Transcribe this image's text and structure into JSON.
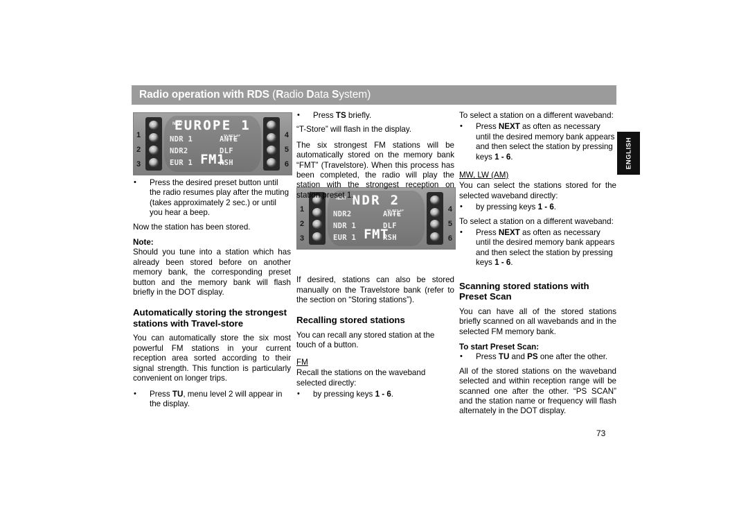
{
  "header": {
    "title_plain_1": "Radio operation with RDS ",
    "title_paren_open": "(",
    "title_r": "R",
    "title_adio": "adio ",
    "title_d": "D",
    "title_ata": "ata ",
    "title_s": "S",
    "title_ystem": "ystem",
    "title_paren_close": ")",
    "full_title": "Radio operation with RDS (Radio Data System)"
  },
  "side_tab": {
    "label": "ENGLISH"
  },
  "page_number": "73",
  "displays": [
    {
      "name": "europe-1-display",
      "next_label": "NEXT",
      "station": "EUROPE  1",
      "band": "FM1",
      "mini_flags_line1": "TA PTY AF",
      "mini_flags_line2": "CD IN",
      "left_numbers": [
        "1",
        "2",
        "3"
      ],
      "right_numbers": [
        "4",
        "5",
        "6"
      ],
      "rows": [
        {
          "bank": "NDR 1",
          "marker": "▸",
          "func": "ANTE"
        },
        {
          "bank": "NDR2",
          "marker": "",
          "func": "DLF"
        },
        {
          "bank": "EUR 1",
          "marker": "◂",
          "func": "RSH"
        }
      ]
    },
    {
      "name": "ndr-2-display",
      "next_label": "NEXT",
      "station": "NDR  2",
      "band": "FMT",
      "mini_flags_line1": "TA PTY AF",
      "mini_flags_line2": "CD IN",
      "left_numbers": [
        "1",
        "2",
        "3"
      ],
      "right_numbers": [
        "4",
        "5",
        "6"
      ],
      "rows": [
        {
          "bank": "NDR2",
          "marker": "◂",
          "func": "ANTE"
        },
        {
          "bank": "NDR 1",
          "marker": "",
          "func": "DLF"
        },
        {
          "bank": "EUR 1",
          "marker": "",
          "func": "RSH"
        }
      ]
    }
  ],
  "column1": {
    "bullet1": {
      "pre": "Press the desired preset button until the radio resumes play after the muting (takes approximately 2 sec.) or until you hear a beep."
    },
    "para_stored": "Now the station has been stored.",
    "note_head": "Note:",
    "note_body": "Should you tune into a station which has already been stored before on another memory bank, the corresponding preset button and the memory bank will flash briefly in the DOT display.",
    "heading_travelstore": "Automatically storing the strongest stations with Travel-store",
    "para_travelstore": "You can automatically store the six most powerful FM stations in your current reception area sorted according to their signal strength. This function is particularly convenient on longer trips.",
    "bullet_tu_pre": "Press ",
    "bullet_tu_bold": "TU",
    "bullet_tu_post": ", menu level 2 will appear in the display."
  },
  "column2": {
    "bullet_ts_pre": "Press ",
    "bullet_ts_bold": "TS",
    "bullet_ts_post": " briefly.",
    "para_tstore": "“T-Store” will flash in the display.",
    "para_six_strongest": "The six strongest FM stations will be automatically stored on the memory bank “FMT” (Travelstore). When this process has been completed, the radio will play the station with the strongest reception on station preset 1.",
    "para_if_desired": "If desired, stations can also be stored manually on the Travelstore bank (refer to the section on “Storing stations”).",
    "heading_recalling": "Recalling stored stations",
    "para_recall": "You can recall any stored station at the touch of a button.",
    "sub_fm": "FM",
    "para_recall_direct": "Recall the stations on the waveband selected directly:",
    "bullet_keys_pre": "by pressing keys ",
    "bullet_keys_bold": "1 - 6",
    "bullet_keys_post": "."
  },
  "column3": {
    "para_select_other_1": "To select a station on a different waveband:",
    "bullet_next_1_pre": "Press ",
    "bullet_next_1_bold": "NEXT",
    "bullet_next_1_mid": " as often as necessary until the desired memory bank appears and then select the station by pressing keys ",
    "bullet_next_1_bold2": "1 - 6",
    "bullet_next_1_post": ".",
    "sub_mwlw": "MW, LW (AM)",
    "para_select_stored": "You can select the stations stored for the selected waveband directly:",
    "bullet_keys_pre": "by pressing keys ",
    "bullet_keys_bold": "1 - 6",
    "bullet_keys_post": ".",
    "para_select_other_2": "To select a station on a different waveband:",
    "bullet_next_2_pre": "Press ",
    "bullet_next_2_bold": "NEXT",
    "bullet_next_2_mid": " as often as necessary until the desired memory bank appears and then select the station by pressing keys ",
    "bullet_next_2_bold2": "1 - 6",
    "bullet_next_2_post": ".",
    "heading_preset_scan": "Scanning stored stations with Preset Scan",
    "para_scan": "You can have all of the stored stations briefly scanned on all wavebands and in the selected FM memory bank.",
    "sub_start": "To start Preset Scan:",
    "bullet_start_pre": "Press ",
    "bullet_start_bold1": "TU",
    "bullet_start_mid": " and ",
    "bullet_start_bold2": "PS",
    "bullet_start_post": " one after the other.",
    "para_all_stored": "All of the stored stations on the waveband selected and within reception range will be scanned one after the other. “PS SCAN” and the station name or frequency will flash alternately in the DOT display."
  }
}
